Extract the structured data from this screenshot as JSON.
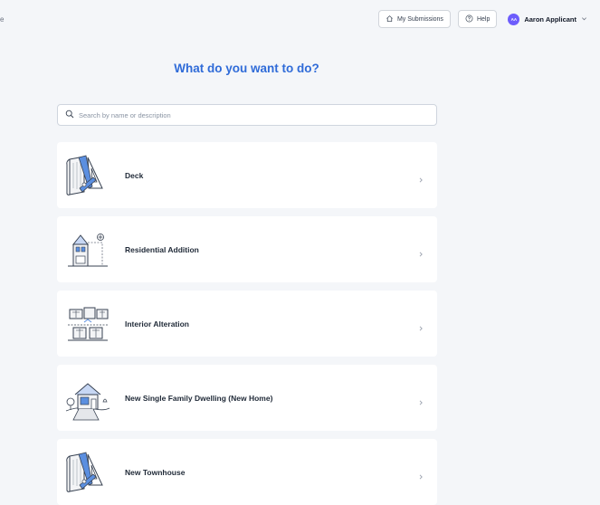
{
  "header": {
    "brand_fragment": "e",
    "submissions_label": "My Submissions",
    "help_label": "Help",
    "user_initials": "AA",
    "user_name": "Aaron Applicant"
  },
  "main": {
    "title": "What do you want to do?",
    "search_placeholder": "Search by name or description",
    "options": [
      {
        "label": "Deck",
        "icon": "tools-icon"
      },
      {
        "label": "Residential Addition",
        "icon": "house-addition-icon"
      },
      {
        "label": "Interior Alteration",
        "icon": "interior-rooms-icon"
      },
      {
        "label": "New Single Family Dwelling (New Home)",
        "icon": "new-home-icon"
      },
      {
        "label": "New Townhouse",
        "icon": "tools-icon"
      }
    ]
  },
  "colors": {
    "accent": "#2f6bd8",
    "background": "#f4f6f9",
    "avatar": "#6d5dfc"
  }
}
